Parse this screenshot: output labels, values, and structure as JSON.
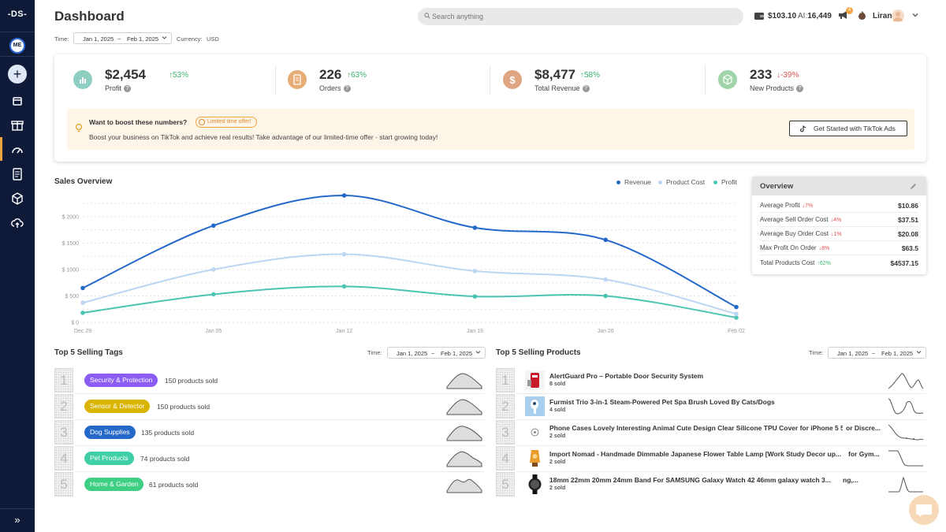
{
  "sidebar": {
    "logo": "-DS-",
    "user_initials": "ME",
    "add_label": "+",
    "expand_label": "»",
    "icons": [
      "store-icon",
      "gift-box-icon",
      "dashboard-gauge-icon",
      "orders-document-icon",
      "products-cube-icon",
      "upload-cloud-icon"
    ]
  },
  "header": {
    "title": "Dashboard",
    "search_placeholder": "Search anything",
    "balance": "$103.10",
    "ai_label": "AI:",
    "ai_credits": "16,449",
    "notification_count": "4",
    "user_name": "Liran"
  },
  "filters": {
    "time_label": "Time:",
    "date_from": "Jan 1, 2025",
    "date_sep": "~",
    "date_to": "Feb 1, 2025",
    "currency_label": "Currency:",
    "currency": "USD"
  },
  "kpis": [
    {
      "value": "$2,454",
      "delta": "↑53%",
      "direction": "up",
      "label": "Profit",
      "icon": "bar-chart-icon",
      "color": "#8fcfc1"
    },
    {
      "value": "226",
      "delta": "↑63%",
      "direction": "up",
      "label": "Orders",
      "icon": "document-icon",
      "color": "#e6ad76"
    },
    {
      "value": "$8,477",
      "delta": "↑58%",
      "direction": "up",
      "label": "Total Revenue",
      "icon": "dollar-icon",
      "color": "#e0a583"
    },
    {
      "value": "233",
      "delta": "↓-39%",
      "direction": "down",
      "label": "New Products",
      "icon": "cube-icon",
      "color": "#9ed4a8"
    }
  ],
  "promo": {
    "title": "Want to boost these numbers?",
    "offer": "Limited time offer!",
    "text": "Boost your business on TikTok and achieve real results! Take advantage of our limited-time offer - start growing today!",
    "button": "Get Started with TikTok Ads"
  },
  "sales_overview": {
    "title": "Sales Overview",
    "legend": [
      "Revenue",
      "Product Cost",
      "Profit"
    ]
  },
  "chart_data": {
    "type": "line",
    "title": "Sales Overview",
    "x": [
      "Dec 29",
      "Jan 05",
      "Jan 12",
      "Jan 19",
      "Jan 26",
      "Feb 02"
    ],
    "ytick_labels": [
      "$ 0",
      "$ 500",
      "$ 1000",
      "$ 1500",
      "$ 2000"
    ],
    "ylim": [
      0,
      2400
    ],
    "grid": true,
    "legend_position": "top-right",
    "series": [
      {
        "name": "Revenue",
        "color": "#2468c9",
        "values": [
          650,
          1830,
          2400,
          1790,
          1560,
          290
        ]
      },
      {
        "name": "Product Cost",
        "color": "#bcd6f3",
        "values": [
          370,
          1000,
          1290,
          970,
          810,
          160
        ]
      },
      {
        "name": "Profit",
        "color": "#4cc4b3",
        "values": [
          180,
          530,
          680,
          490,
          500,
          90
        ]
      }
    ]
  },
  "overview": {
    "title": "Overview",
    "rows": [
      {
        "name": "Average Profit",
        "delta": "↓7%",
        "direction": "down",
        "value": "$10.86"
      },
      {
        "name": "Average Sell Order Cost",
        "delta": "↓4%",
        "direction": "down",
        "value": "$37.51"
      },
      {
        "name": "Average Buy Order Cost",
        "delta": "↓1%",
        "direction": "down",
        "value": "$20.08"
      },
      {
        "name": "Max Profit On Order",
        "delta": "↓8%",
        "direction": "down",
        "value": "$63.5"
      },
      {
        "name": "Total Products Cost",
        "delta": "↑62%",
        "direction": "up",
        "value": "$4537.15"
      }
    ]
  },
  "top_tags": {
    "title": "Top 5 Selling Tags",
    "time_label": "Time:",
    "date_from": "Jan 1, 2025",
    "date_sep": "~",
    "date_to": "Feb 1, 2025",
    "rows": [
      {
        "rank": "1",
        "tag": "Security & Protection",
        "color": "#8b5cf6",
        "sold": "150 products sold"
      },
      {
        "rank": "2",
        "tag": "Sensor & Detector",
        "color": "#d9b400",
        "sold": "150 products sold"
      },
      {
        "rank": "3",
        "tag": "Dog Supplies",
        "color": "#2468c9",
        "sold": "135 products sold"
      },
      {
        "rank": "4",
        "tag": "Pet Products",
        "color": "#3ecfa6",
        "sold": "74 products sold"
      },
      {
        "rank": "5",
        "tag": "Home & Garden",
        "color": "#3ecf85",
        "sold": "61 products sold"
      }
    ]
  },
  "top_products": {
    "title": "Top 5 Selling Products",
    "time_label": "Time:",
    "date_from": "Jan 1, 2025",
    "date_sep": "~",
    "date_to": "Feb 1, 2025",
    "rows": [
      {
        "rank": "1",
        "name": "AlertGuard Pro – Portable Door Security System",
        "suffix": "",
        "sold": "8 sold",
        "thumb": "door-alarm-image"
      },
      {
        "rank": "2",
        "name": "Furmist Trio 3-in-1 Steam-Powered Pet Spa Brush Loved By Cats/Dogs",
        "suffix": "",
        "sold": "4 sold",
        "thumb": "pet-brush-image"
      },
      {
        "rank": "3",
        "name": "Phone Cases Lovely Interesting Animal Cute Design Clear Silicone TPU Cover for iPhone 5 5S...",
        "suffix": "or Discre...",
        "sold": "2 sold",
        "thumb": "placeholder-image"
      },
      {
        "rank": "4",
        "name": "Import Nomad - Handmade Dimmable Japanese Flower Table Lamp [Work Study Decor up...",
        "suffix": "for Gym...",
        "sold": "2 sold",
        "thumb": "lamp-image"
      },
      {
        "rank": "5",
        "name": "18mm 22mm 20mm 24mm Band For SAMSUNG Galaxy Watch 42 46mm galaxy watch 3...",
        "suffix": "ng,...",
        "sold": "2 sold",
        "thumb": "watch-band-image"
      }
    ]
  }
}
